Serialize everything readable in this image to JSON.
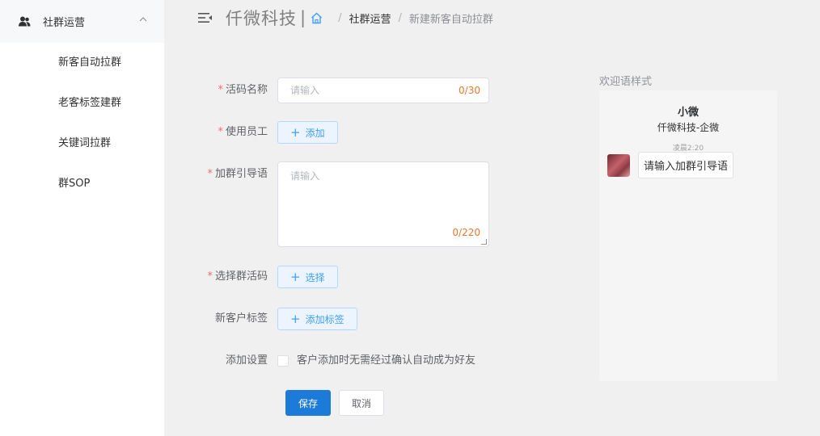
{
  "sidebar": {
    "group_label": "社群运营",
    "items": [
      {
        "label": "新客自动拉群"
      },
      {
        "label": "老客标签建群"
      },
      {
        "label": "关键词拉群"
      },
      {
        "label": "群SOP"
      }
    ]
  },
  "header": {
    "brand": "仟微科技",
    "brand_sep": "|",
    "breadcrumb": {
      "sep": "/",
      "parent": "社群运营",
      "current": "新建新客自动拉群"
    }
  },
  "form": {
    "code_name": {
      "label": "活码名称",
      "required_mark": "*",
      "placeholder": "请输入",
      "count": "0/30"
    },
    "staff": {
      "label": "使用员工",
      "required_mark": "*",
      "button": "添加",
      "plus": "+"
    },
    "guide": {
      "label": "加群引导语",
      "required_mark": "*",
      "placeholder": "请输入",
      "count": "0/220"
    },
    "group_code": {
      "label": "选择群活码",
      "required_mark": "*",
      "button": "选择",
      "plus": "+"
    },
    "tags": {
      "label": "新客户标签",
      "button": "添加标签",
      "plus": "+"
    },
    "settings": {
      "label": "添加设置",
      "checkbox_text": "客户添加时无需经过确认自动成为好友"
    },
    "save": "保存",
    "cancel": "取消"
  },
  "preview": {
    "title": "欢迎语样式",
    "name": "小微",
    "company": "仟微科技-企微",
    "time": "凌晨2:20",
    "message": "请输入加群引导语"
  }
}
